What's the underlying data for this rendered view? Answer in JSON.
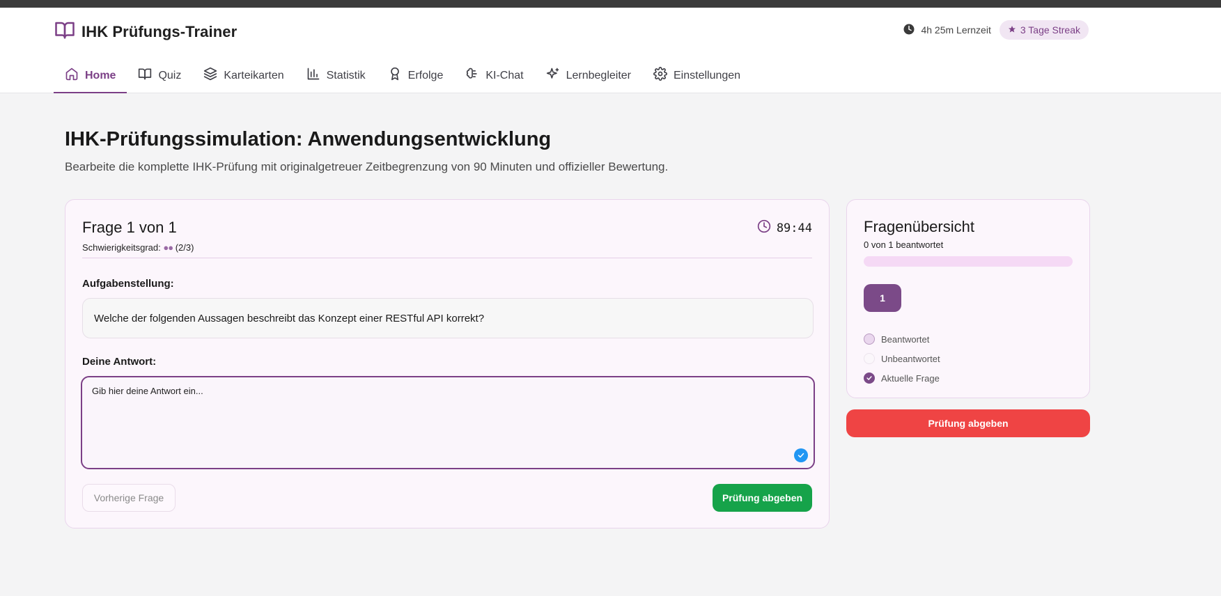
{
  "app": {
    "title": "IHK Prüfungs-Trainer",
    "lernzeit": "4h 25m Lernzeit",
    "streak": "3 Tage Streak"
  },
  "nav": {
    "items": [
      {
        "label": "Home",
        "icon": "home-icon",
        "active": true
      },
      {
        "label": "Quiz",
        "icon": "book-open-icon",
        "active": false
      },
      {
        "label": "Karteikarten",
        "icon": "layers-icon",
        "active": false
      },
      {
        "label": "Statistik",
        "icon": "bar-chart-icon",
        "active": false
      },
      {
        "label": "Erfolge",
        "icon": "award-icon",
        "active": false
      },
      {
        "label": "KI-Chat",
        "icon": "brain-icon",
        "active": false
      },
      {
        "label": "Lernbegleiter",
        "icon": "sparkles-icon",
        "active": false
      },
      {
        "label": "Einstellungen",
        "icon": "gear-icon",
        "active": false
      }
    ]
  },
  "page": {
    "title": "IHK-Prüfungssimulation: Anwendungsentwicklung",
    "subtitle": "Bearbeite die komplette IHK-Prüfung mit originalgetreuer Zeitbegrenzung von 90 Minuten und offizieller Bewertung."
  },
  "question": {
    "header": "Frage 1 von 1",
    "difficulty_label": "Schwierigkeitsgrad:",
    "difficulty_dots": "●●",
    "difficulty_value": "(2/3)",
    "timer": "89:44",
    "task_label": "Aufgabenstellung:",
    "task_text": "Welche der folgenden Aussagen beschreibt das Konzept einer RESTful API korrekt?",
    "answer_label": "Deine Antwort:",
    "answer_placeholder": "Gib hier deine Antwort ein...",
    "answer_value": "",
    "prev_button": "Vorherige Frage",
    "submit_button": "Prüfung abgeben"
  },
  "overview": {
    "title": "Fragenübersicht",
    "count_text": "0 von 1 beantwortet",
    "progress": 0,
    "question_numbers": [
      "1"
    ],
    "legend": {
      "answered": "Beantwortet",
      "unanswered": "Unbeantwortet",
      "current": "Aktuelle Frage"
    },
    "submit_button": "Prüfung abgeben"
  },
  "colors": {
    "accent": "#7b3f86",
    "success": "#16a34a",
    "danger": "#ef4444",
    "grammar": "#2196f3"
  }
}
